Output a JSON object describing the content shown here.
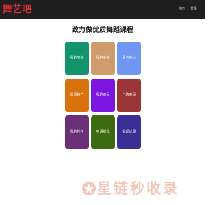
{
  "header": {
    "logo_text": "舞艺吧",
    "nav": [
      {
        "label": "注册"
      },
      {
        "label": "登录"
      }
    ]
  },
  "main": {
    "headline": "致力做优质舞蹈课程",
    "tiles": [
      {
        "label": "我的买家",
        "color": "#12946c"
      },
      {
        "label": "我的卖家",
        "color": "#cf9d6b"
      },
      {
        "label": "服务中心",
        "color": "#6f97f2"
      },
      {
        "label": "邀请推广",
        "color": "#d9730d"
      },
      {
        "label": "我的商品",
        "color": "#7b16e0"
      },
      {
        "label": "已购商品",
        "color": "#9b3636"
      },
      {
        "label": "我的授权",
        "color": "#6b2f78"
      },
      {
        "label": "申请提现",
        "color": "#3d6b10"
      },
      {
        "label": "提现记录",
        "color": "#3a2f94"
      }
    ]
  },
  "watermark": {
    "text": "星链秒收录",
    "color": "#f2c6b8"
  }
}
